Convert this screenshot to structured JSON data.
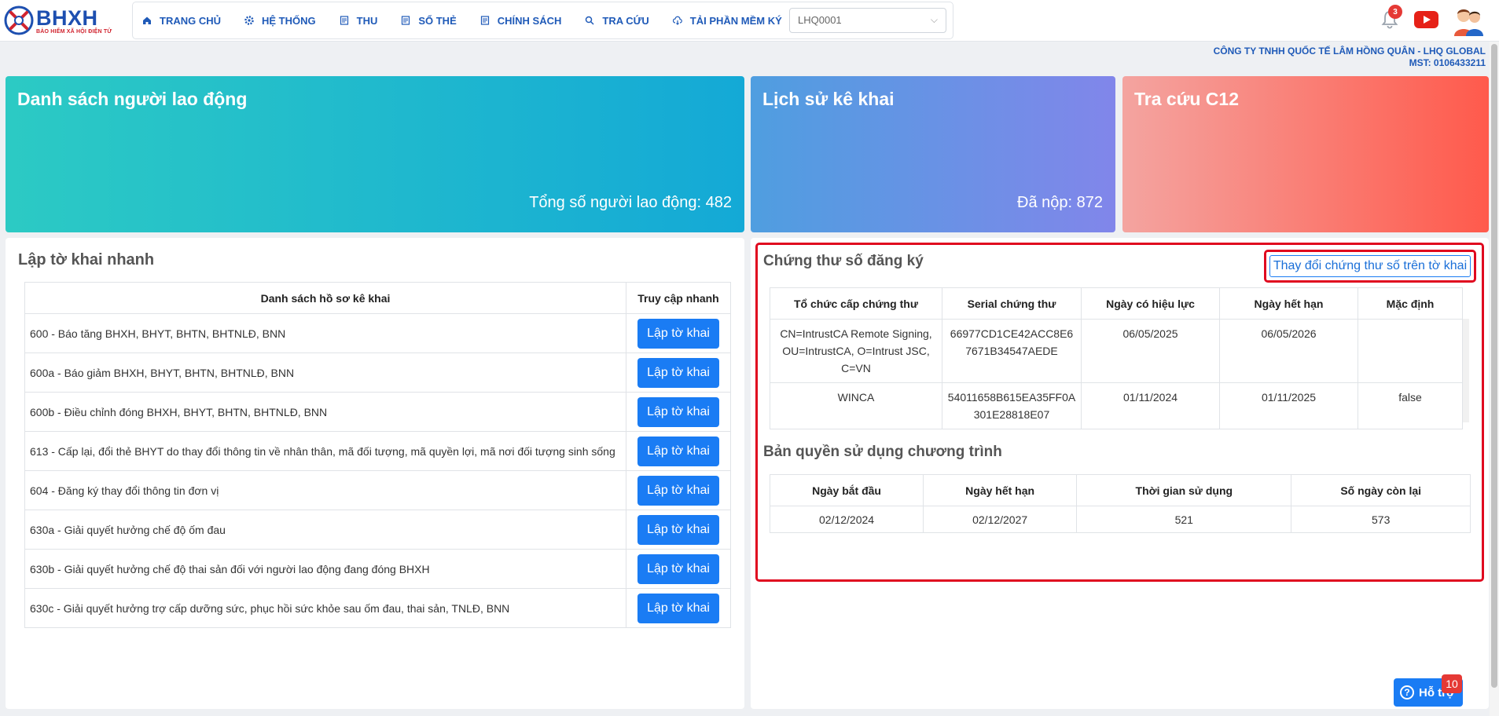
{
  "header": {
    "logo_title": "BHXH",
    "logo_subtitle": "BẢO HIỂM XÃ HỘI ĐIỆN TỬ",
    "nav": [
      {
        "label": "TRANG CHỦ",
        "icon": "home-icon"
      },
      {
        "label": "HỆ THỐNG",
        "icon": "gear-icon"
      },
      {
        "label": "THU",
        "icon": "document-icon"
      },
      {
        "label": "SỔ THẺ",
        "icon": "card-icon"
      },
      {
        "label": "CHÍNH SÁCH",
        "icon": "policy-icon"
      },
      {
        "label": "TRA CỨU",
        "icon": "search-icon"
      },
      {
        "label": "TẢI PHẦN MỀM KÝ",
        "icon": "download-cloud-icon"
      }
    ],
    "company_select_value": "LHQ0001",
    "notification_count": "3",
    "company_name": "CÔNG TY TNHH QUỐC TẾ LÂM HỒNG QUÂN - LHQ GLOBAL",
    "tax_code": "MST: 0106433211"
  },
  "cards": [
    {
      "title": "Danh sách người lao động",
      "stat": "Tổng số người lao động: 482"
    },
    {
      "title": "Lịch sử kê khai",
      "stat": "Đã nộp: 872"
    },
    {
      "title": "Tra cứu C12",
      "stat": ""
    }
  ],
  "quick_declare": {
    "title": "Lập tờ khai nhanh",
    "col_list": "Danh sách hồ sơ kê khai",
    "col_access": "Truy cập nhanh",
    "button_label": "Lập tờ khai",
    "rows": [
      "600 - Báo tăng BHXH, BHYT, BHTN, BHTNLĐ, BNN",
      "600a - Báo giảm BHXH, BHYT, BHTN, BHTNLĐ, BNN",
      "600b - Điều chỉnh đóng BHXH, BHYT, BHTN, BHTNLĐ, BNN",
      "613 - Cấp lại, đổi thẻ BHYT do thay đổi thông tin về nhân thân, mã đối tượng, mã quyền lợi, mã nơi đối tượng sinh sống",
      "604 - Đăng ký thay đổi thông tin đơn vị",
      "630a - Giải quyết hưởng chế độ ốm đau",
      "630b - Giải quyết hưởng chế độ thai sản đối với người lao động đang đóng BHXH",
      "630c - Giải quyết hưởng trợ cấp dưỡng sức, phục hồi sức khỏe sau ốm đau, thai sản, TNLĐ, BNN"
    ]
  },
  "certificates": {
    "title": "Chứng thư số đăng ký",
    "change_button": "Thay đổi chứng thư số trên tờ khai",
    "headers": [
      "Tổ chức cấp chứng thư",
      "Serial chứng thư",
      "Ngày có hiệu lực",
      "Ngày hết hạn",
      "Mặc định"
    ],
    "rows": [
      {
        "issuer": "CN=IntrustCA Remote Signing, OU=IntrustCA, O=Intrust JSC, C=VN",
        "serial": "66977CD1CE42ACC8E67671B34547AEDE",
        "valid_from": "06/05/2025",
        "expires": "06/05/2026",
        "default": ""
      },
      {
        "issuer": "WINCA",
        "serial": "54011658B615EA35FF0A301E28818E07",
        "valid_from": "01/11/2024",
        "expires": "01/11/2025",
        "default": "false"
      }
    ]
  },
  "license": {
    "title": "Bản quyền sử dụng chương trình",
    "headers": [
      "Ngày bắt đầu",
      "Ngày hết hạn",
      "Thời gian sử dụng",
      "Số ngày còn lại"
    ],
    "row": {
      "start": "02/12/2024",
      "end": "02/12/2027",
      "used": "521",
      "remaining": "573"
    }
  },
  "help": {
    "label": "Hỗ trợ",
    "badge": "10"
  }
}
